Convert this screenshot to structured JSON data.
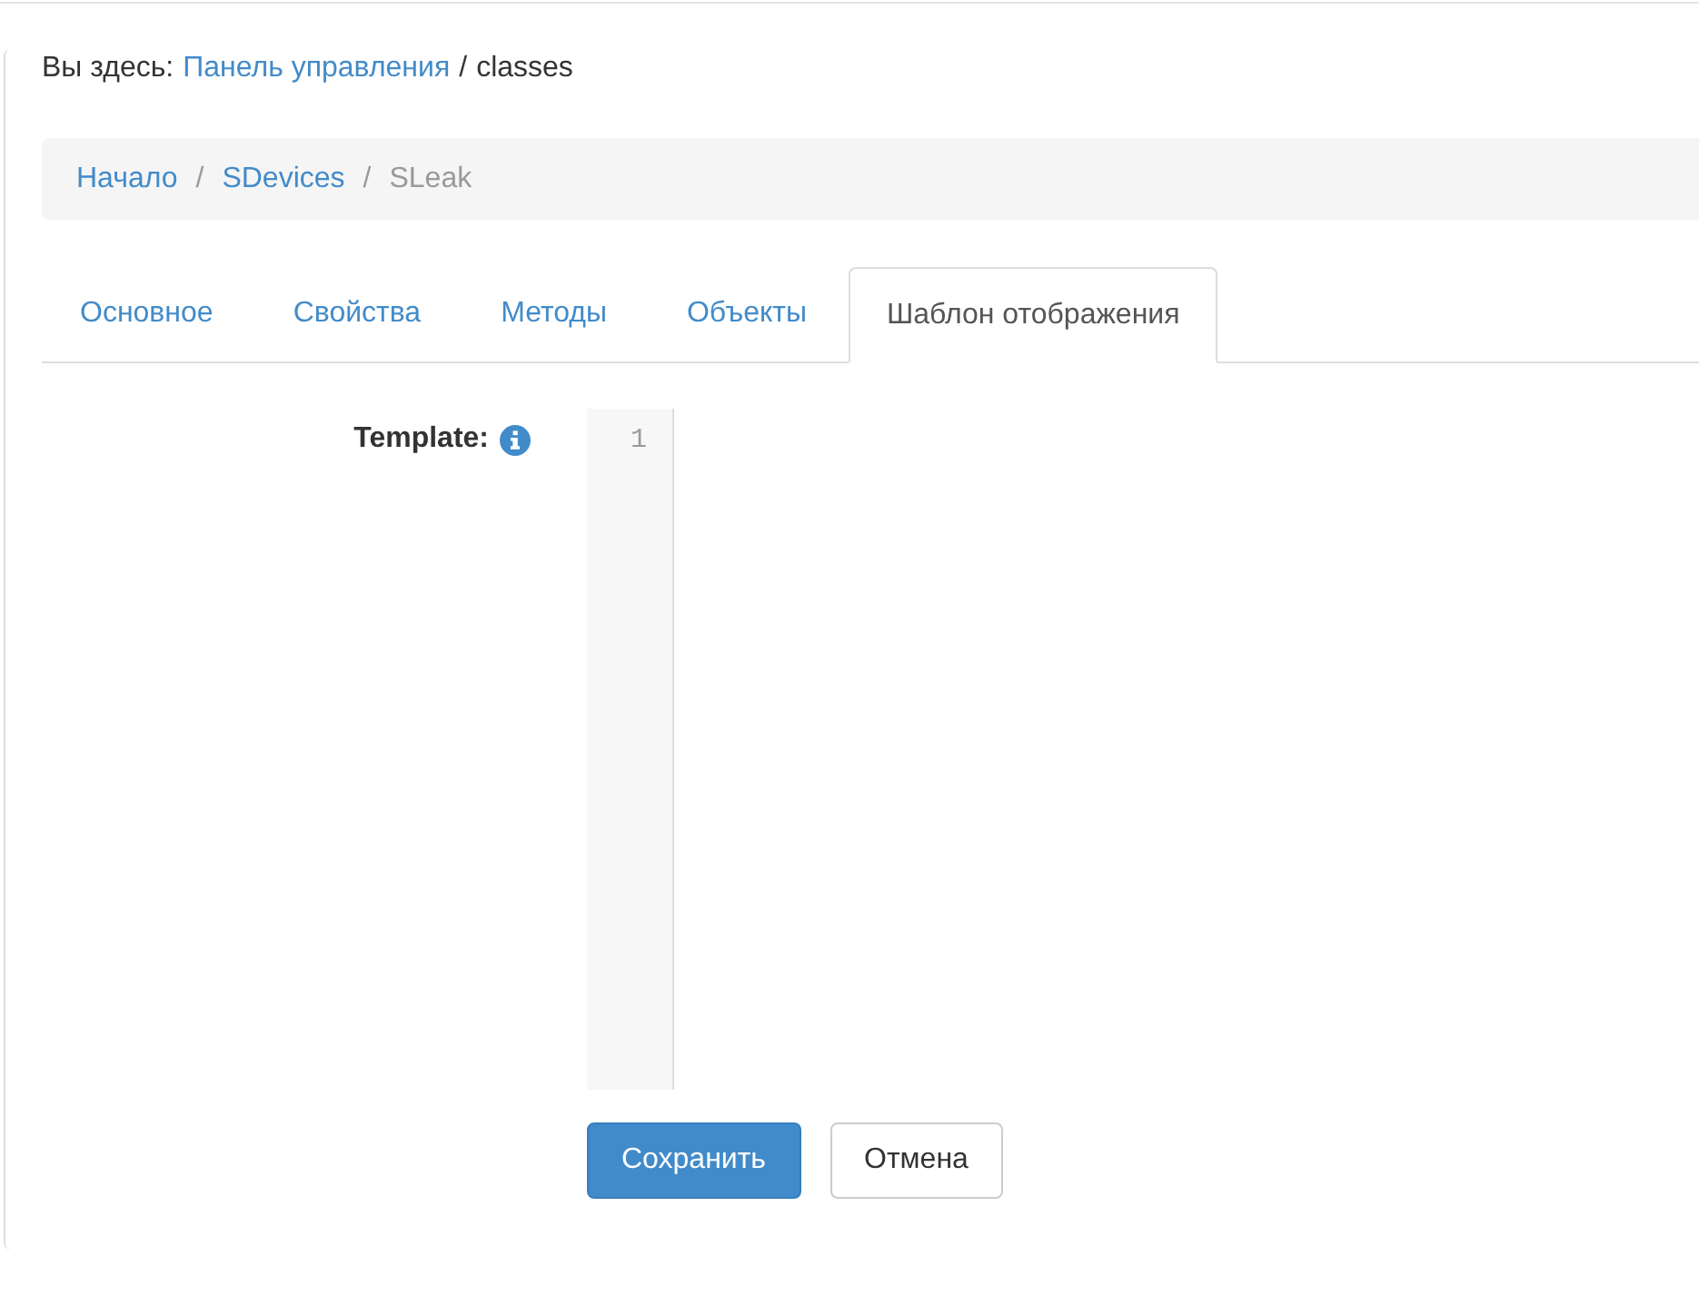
{
  "location": {
    "label": "Вы здесь:",
    "link": "Панель управления",
    "separator": "/",
    "current": "classes"
  },
  "breadcrumb": {
    "items": [
      {
        "label": "Начало",
        "selected": false
      },
      {
        "label": "SDevices",
        "selected": false
      },
      {
        "label": "SLeak",
        "selected": true
      }
    ],
    "separators": [
      "/",
      "/"
    ]
  },
  "tabs": [
    {
      "label": "Основное",
      "selected": false
    },
    {
      "label": "Свойства",
      "selected": false
    },
    {
      "label": "Методы",
      "selected": false
    },
    {
      "label": "Объекты",
      "selected": false
    },
    {
      "label": "Шаблон отображения",
      "selected": true
    }
  ],
  "form": {
    "label": "Template:",
    "editor": {
      "line_numbers": [
        "1"
      ]
    }
  },
  "buttons": [
    {
      "label": "Сохранить",
      "kind": "primary"
    },
    {
      "label": "Отмена",
      "kind": "default"
    }
  ]
}
